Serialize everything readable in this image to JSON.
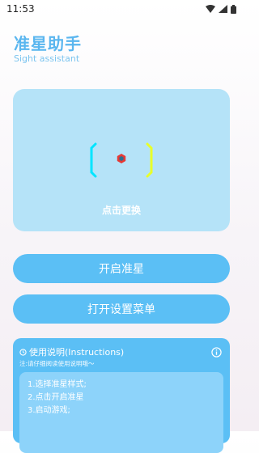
{
  "status_bar": {
    "time": "11:53",
    "icons": [
      "wifi-icon",
      "signal-icon",
      "battery-icon"
    ]
  },
  "header": {
    "title": "准星助手",
    "subtitle": "Sight assistant"
  },
  "preview": {
    "caption": "点击更换"
  },
  "buttons": {
    "enable_label": "开启准星",
    "settings_label": "打开设置菜单"
  },
  "instructions": {
    "title": "使用说明(Instructions)",
    "note": "注:请仔细阅读使用说明哦～",
    "steps": [
      "1.选择准星样式;",
      "2.点击开启准星",
      "3.启动游戏;"
    ]
  },
  "colors": {
    "accent": "#5bbff5",
    "title": "#5ab6ef",
    "preview_bg": "#b5e3f8",
    "crosshair_left": "#00e5ff",
    "crosshair_right": "#e8ff2a",
    "crosshair_center": "#e53935"
  }
}
